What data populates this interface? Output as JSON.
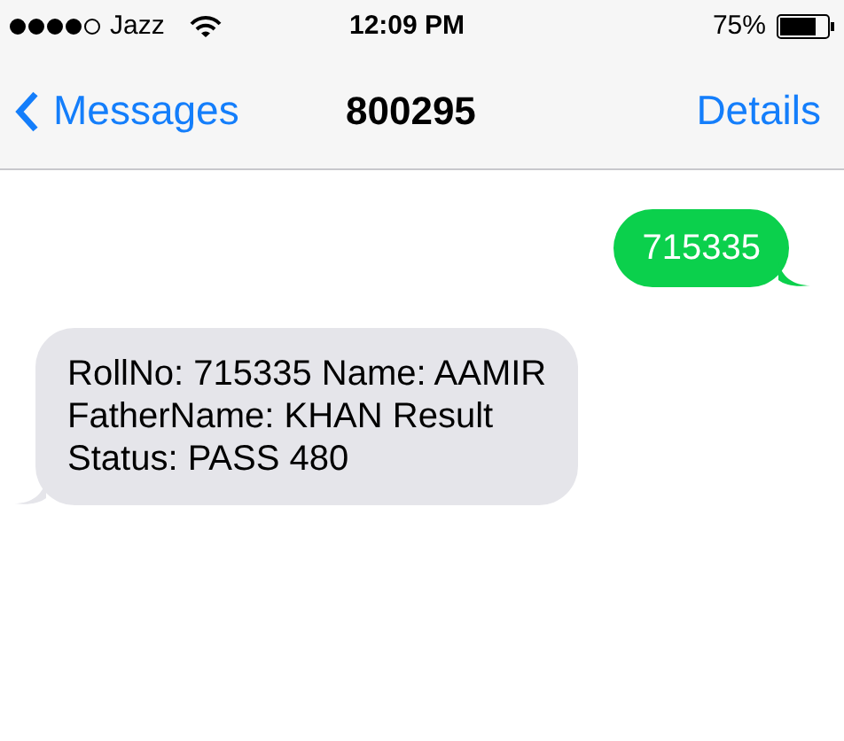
{
  "status_bar": {
    "carrier": "Jazz",
    "time": "12:09 PM",
    "battery": "75%"
  },
  "nav_bar": {
    "back": "Messages",
    "title": "800295",
    "action": "Details"
  },
  "messages": [
    {
      "kind": "sent",
      "text": "715335"
    },
    {
      "kind": "received",
      "text": "RollNo: 715335 Name: AAMIR FatherName: KHAN Result Status: PASS 480"
    }
  ]
}
